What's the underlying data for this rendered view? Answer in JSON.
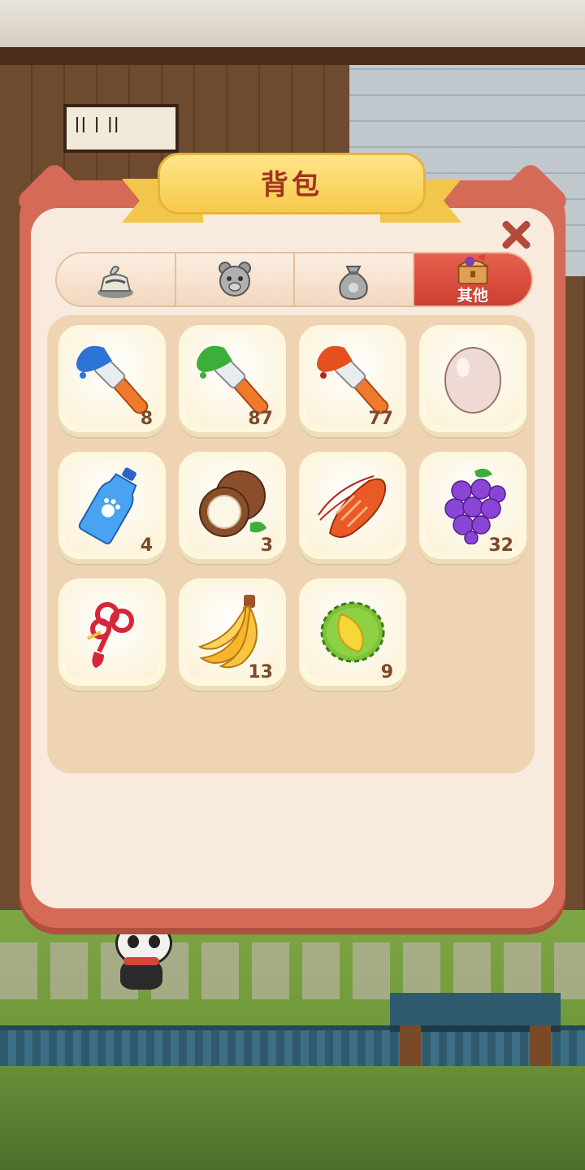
{
  "dialog": {
    "title": "背包",
    "close_icon": "close-x-icon"
  },
  "tabs": [
    {
      "icon": "dessert-icon",
      "label": "",
      "active": false
    },
    {
      "icon": "bear-toy-icon",
      "label": "",
      "active": false
    },
    {
      "icon": "sack-icon",
      "label": "",
      "active": false
    },
    {
      "icon": "treasure-chest-icon",
      "label": "其他",
      "active": true
    }
  ],
  "items": [
    {
      "icon": "blue-paintbrush-icon",
      "count": "8"
    },
    {
      "icon": "green-paintbrush-icon",
      "count": "87"
    },
    {
      "icon": "orange-paintbrush-icon",
      "count": "77"
    },
    {
      "icon": "egg-icon",
      "count": ""
    },
    {
      "icon": "water-bottle-icon",
      "count": "4"
    },
    {
      "icon": "coconut-icon",
      "count": "3"
    },
    {
      "icon": "lobster-icon",
      "count": ""
    },
    {
      "icon": "grapes-icon",
      "count": "32"
    },
    {
      "icon": "chinese-knot-icon",
      "count": ""
    },
    {
      "icon": "banana-icon",
      "count": "13"
    },
    {
      "icon": "durian-icon",
      "count": "9"
    }
  ],
  "colors": {
    "frame": "#d56a56",
    "paper": "#f8eadc",
    "active_tab": "#cc3f33",
    "ribbon": "#f6c94a",
    "count_text": "#7b4a2b"
  }
}
